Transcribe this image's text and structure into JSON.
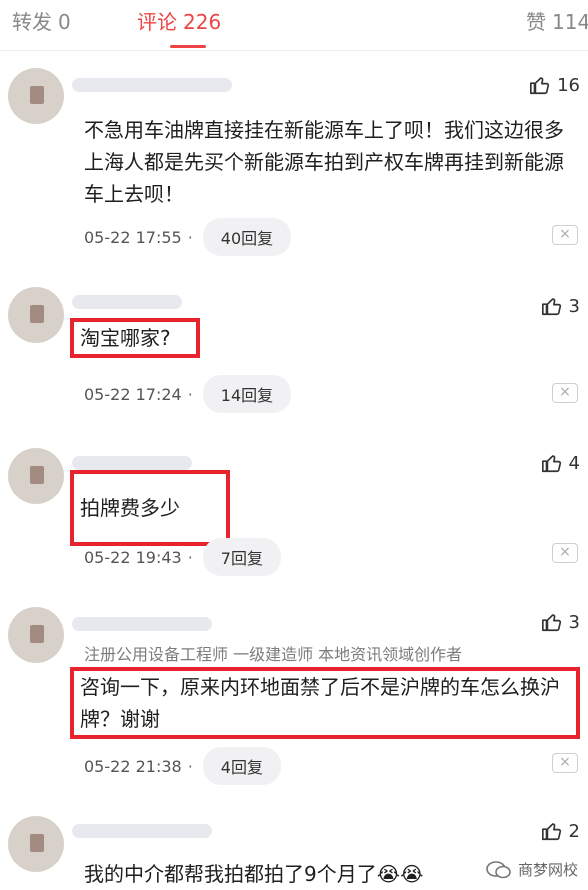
{
  "tabs": {
    "repost": {
      "label": "转发",
      "count": "0"
    },
    "comments": {
      "label": "评论",
      "count": "226"
    },
    "likes": {
      "label": "赞",
      "count": "114"
    }
  },
  "comments": [
    {
      "likes": "16",
      "text": "不急用车油牌直接挂在新能源车上了呗！我们这边很多上海人都是先买个新能源车拍到产权车牌再挂到新能源车上去呗！",
      "time": "05-22 17:55",
      "replies": "40回复",
      "close": "×"
    },
    {
      "likes": "3",
      "text": "淘宝哪家?",
      "time": "05-22 17:24",
      "replies": "14回复",
      "close": "×"
    },
    {
      "likes": "4",
      "text": "拍牌费多少",
      "time": "05-22 19:43",
      "replies": "7回复",
      "close": "×"
    },
    {
      "likes": "3",
      "role": "注册公用设备工程师 一级建造师 本地资讯领域创作者",
      "text": "咨询一下，原来内环地面禁了后不是沪牌的车怎么换沪牌？谢谢",
      "time": "05-22 21:38",
      "replies": "4回复",
      "close": "×"
    },
    {
      "likes": "2",
      "text": "我的中介都帮我拍都拍了9个月了😭😭"
    }
  ],
  "watermark": "商梦网校",
  "colors": {
    "accent": "#ee4444",
    "highlight_box": "#e8232d"
  }
}
